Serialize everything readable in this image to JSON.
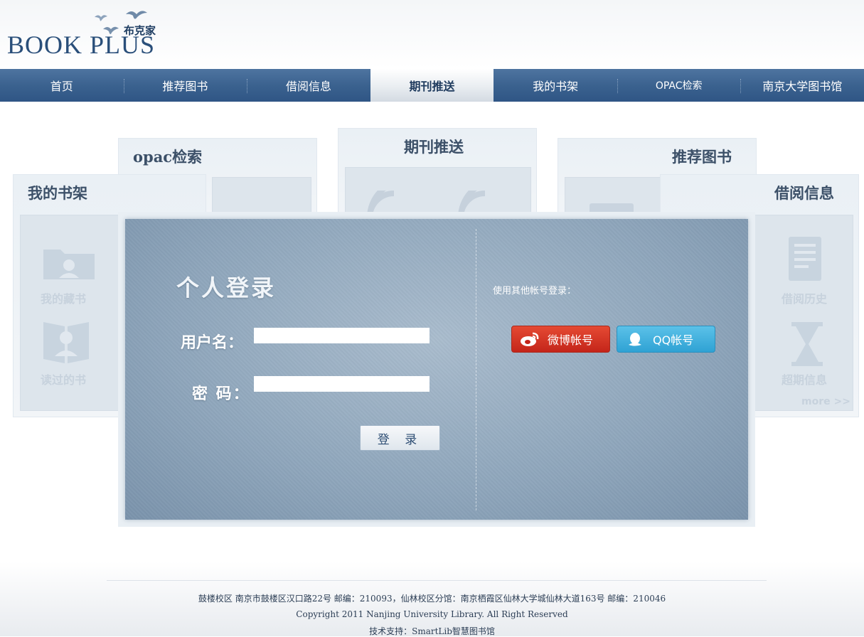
{
  "logo": {
    "text": "BOOK PLUS",
    "cn": "布克家"
  },
  "nav": [
    {
      "label": "首页"
    },
    {
      "label": "推荐图书"
    },
    {
      "label": "借阅信息"
    },
    {
      "label": "期刊推送"
    },
    {
      "label": "我的书架"
    },
    {
      "label": "OPAC检索"
    },
    {
      "label": "南京大学图书馆"
    }
  ],
  "cards": {
    "opac": "opac检索",
    "journal": "期刊推送",
    "recommend": "推荐图书",
    "shelf": "我的书架",
    "borrow": "借阅信息",
    "shelf_items": [
      "我的藏书",
      "读过的书"
    ],
    "borrow_items": [
      "借阅历史",
      "超期信息"
    ],
    "more": "more >>"
  },
  "login": {
    "title": "个人登录",
    "username_label": "用户名：",
    "password_label": "密 码：",
    "username_value": "",
    "password_value": "",
    "submit": "登 录",
    "other_label": "使用其他帐号登录：",
    "weibo": "微博帐号",
    "qq": "QQ帐号"
  },
  "footer": {
    "address": "鼓楼校区 南京市鼓楼区汉口路22号 邮编：210093，仙林校区分馆：南京栖霞区仙林大学城仙林大道163号 邮编：210046",
    "copyright": "Copyright 2011 Nanjing University Library. All Right Reserved",
    "support": "技术支持：SmartLib智慧图书馆"
  },
  "colors": {
    "nav": "#3b628f",
    "accent": "#2a4f7a",
    "weibo": "#d0301f",
    "qq": "#3ab0de"
  }
}
